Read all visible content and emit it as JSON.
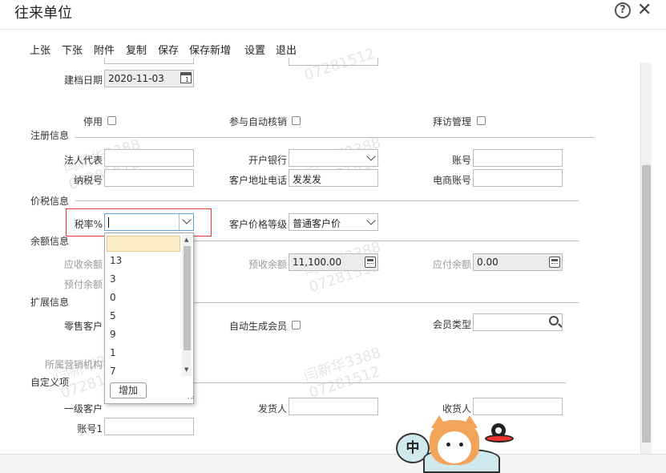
{
  "window": {
    "title": "往来单位"
  },
  "toolbar": {
    "items": [
      "上张",
      "下张",
      "附件",
      "复制",
      "保存",
      "保存新增",
      "设置",
      "退出"
    ]
  },
  "fields": {
    "created_date_label": "建档日期",
    "created_date_value": "2020-11-03",
    "disabled_label": "停用",
    "auto_writeoff_label": "参与自动核销",
    "visit_mgmt_label": "拜访管理",
    "legal_rep_label": "法人代表",
    "bank_label": "开户银行",
    "account_label": "账号",
    "tax_id_label": "纳税号",
    "address_phone_label": "客户地址电话",
    "address_phone_value": "发发发",
    "ecom_account_label": "电商账号",
    "tax_rate_label": "税率%",
    "price_level_label": "客户价格等级",
    "price_level_value": "普通客户价",
    "receivable_label": "应收余额",
    "prepaid_recv_label": "预收余额",
    "prepaid_recv_value": "11,100.00",
    "payable_label": "应付余额",
    "payable_value": "0.00",
    "prepay_label": "预付余额",
    "retail_label": "零售客户",
    "auto_member_label": "自动生成会员",
    "member_type_label": "会员类型",
    "org_label": "所属营销机构",
    "level1_customer_label": "一级客户",
    "shipper_label": "发货人",
    "receiver_label": "收货人",
    "account1_label": "账号1"
  },
  "sections": {
    "registration": "注册信息",
    "price_tax": "价税信息",
    "balance": "余额信息",
    "extension": "扩展信息",
    "custom": "自定义项"
  },
  "tax_dropdown": {
    "options": [
      "",
      "13",
      "3",
      "0",
      "5",
      "9",
      "1",
      "7"
    ],
    "add_label": "增加"
  },
  "watermark": {
    "name": "闫新华3388",
    "code": "07281512"
  },
  "mascot": {
    "bubble_text": "中"
  }
}
